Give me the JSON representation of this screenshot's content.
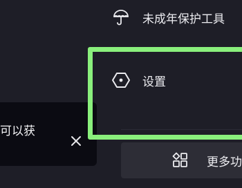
{
  "menu": {
    "minor_protection": {
      "label": "未成年保护工具",
      "icon": "umbrella-icon"
    },
    "settings": {
      "label": "设置",
      "icon": "hexagon-settings-icon"
    },
    "more_features": {
      "label": "更多功",
      "icon": "grid-apps-icon"
    }
  },
  "toast": {
    "text": "可以获",
    "close_icon": "close-icon"
  },
  "colors": {
    "background": "#1e1e27",
    "text": "#ececf0",
    "highlight": "#8af07c",
    "toast_background": "#0b0b12",
    "button_background": "#2d2d36"
  }
}
